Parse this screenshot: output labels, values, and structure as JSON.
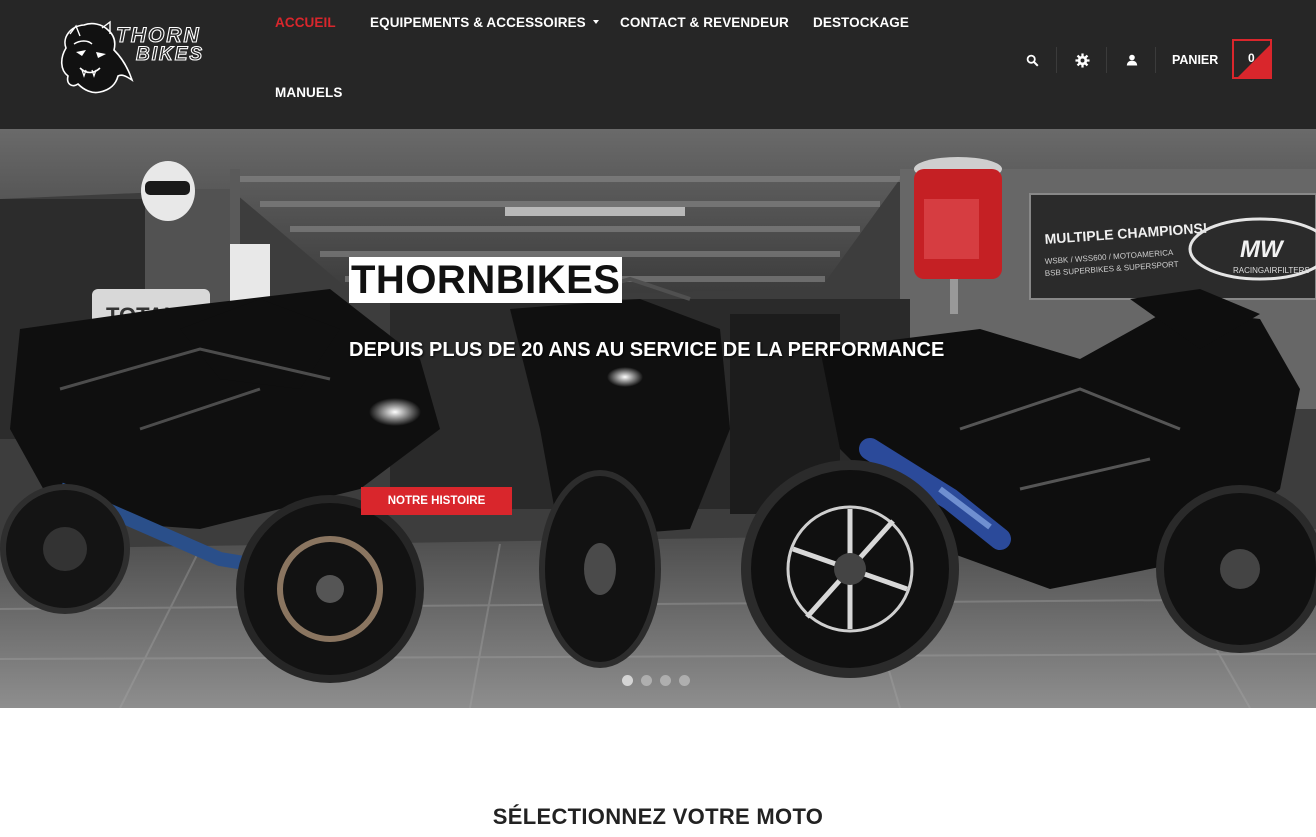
{
  "brand": {
    "logo_top": "THORN",
    "logo_bottom": "BIKES"
  },
  "nav": {
    "items": [
      {
        "label": "ACCUEIL",
        "active": true
      },
      {
        "label": "EQUIPEMENTS & ACCESSOIRES",
        "dropdown": true
      },
      {
        "label": "CONTACT & REVENDEUR"
      },
      {
        "label": "DESTOCKAGE"
      },
      {
        "label": "MANUELS"
      }
    ]
  },
  "toolbar": {
    "icons": [
      "search-icon",
      "gear-icon",
      "user-icon"
    ],
    "cart_label": "PANIER",
    "cart_count": "0"
  },
  "hero": {
    "title": "THORNBIKES",
    "subtitle": "DEPUIS PLUS DE 20 ANS AU SERVICE DE LA PERFORMANCE",
    "button_label": "NOTRE HISTOIRE",
    "slides": 4,
    "active_slide": 1,
    "signage": {
      "fuel_brand": "TOTAL",
      "banner_line": "MULTIPLE CHAMPIONS!",
      "banner_small": "WSBK / WSS600 / MOTOAMERICA",
      "banner_small2": "BSB SUPERBIKES & SUPERSPORT",
      "banner_brand": "MW",
      "banner_site": "RACINGAIRFILTERS"
    }
  },
  "main": {
    "section_title": "SÉLECTIONNEZ VOTRE MOTO"
  },
  "colors": {
    "header_bg": "#262626",
    "accent": "#d9262c",
    "text_light": "#ffffff"
  }
}
